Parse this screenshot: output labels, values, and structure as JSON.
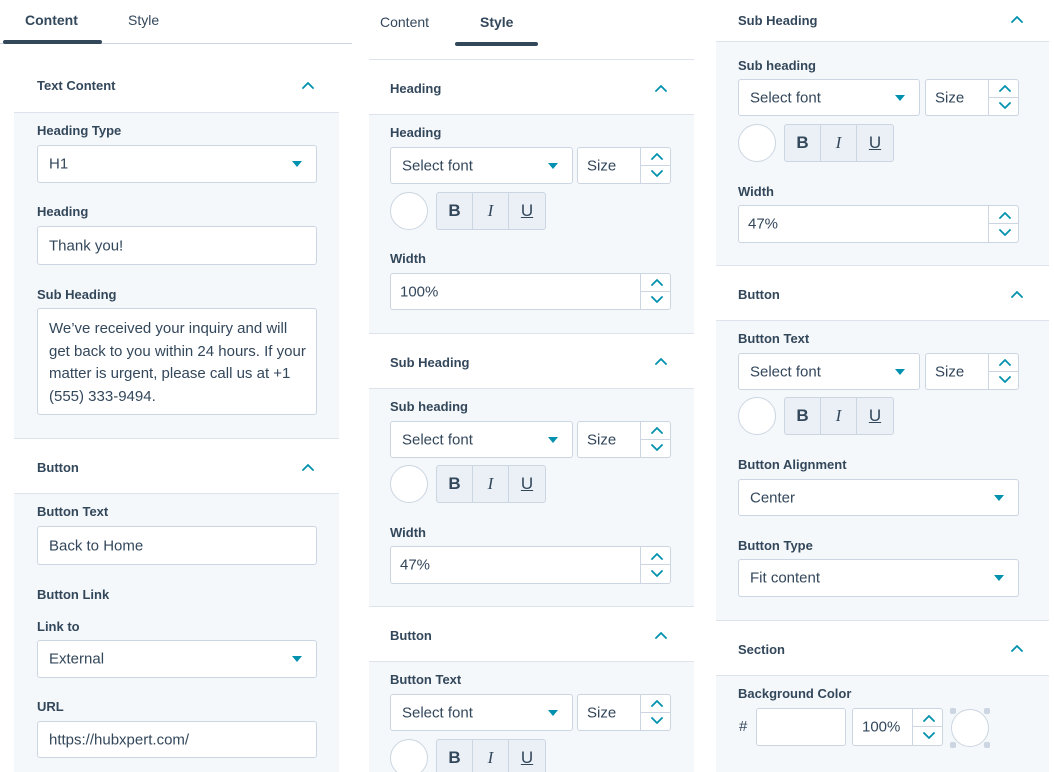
{
  "colors": {
    "accent": "#0091ae",
    "text": "#33475b",
    "border": "#cbd6e2",
    "body_bg": "#f5f8fa",
    "tab_underline": "#33475b"
  },
  "panel1": {
    "tabs": {
      "content": "Content",
      "style": "Style",
      "active": "Content"
    },
    "text_content": {
      "title": "Text Content",
      "heading_type_label": "Heading Type",
      "heading_type_value": "H1",
      "heading_label": "Heading",
      "heading_value": "Thank you!",
      "sub_heading_label": "Sub Heading",
      "sub_heading_value": "We’ve received your inquiry and will get back to you within 24 hours. If your matter is urgent, please call us at +1 (555) 333-9494."
    },
    "button": {
      "title": "Button",
      "text_label": "Button Text",
      "text_value": "Back to Home",
      "link_label": "Button Link",
      "link_to_label": "Link to",
      "link_to_value": "External",
      "url_label": "URL",
      "url_value": "https://hubxpert.com/"
    }
  },
  "panel2": {
    "tabs": {
      "content": "Content",
      "style": "Style",
      "active": "Style"
    },
    "heading": {
      "title": "Heading",
      "label": "Heading",
      "font_placeholder": "Select font",
      "size_placeholder": "Size",
      "bold": "B",
      "italic": "I",
      "underline": "U",
      "width_label": "Width",
      "width_value": "100%"
    },
    "sub_heading": {
      "title": "Sub Heading",
      "label": "Sub heading",
      "font_placeholder": "Select font",
      "size_placeholder": "Size",
      "bold": "B",
      "italic": "I",
      "underline": "U",
      "width_label": "Width",
      "width_value": "47%"
    },
    "button": {
      "title": "Button",
      "label": "Button Text",
      "font_placeholder": "Select font",
      "size_placeholder": "Size",
      "bold": "B",
      "italic": "I",
      "underline": "U"
    }
  },
  "panel3": {
    "sub_heading": {
      "title": "Sub Heading",
      "label": "Sub heading",
      "font_placeholder": "Select font",
      "size_placeholder": "Size",
      "bold": "B",
      "italic": "I",
      "underline": "U",
      "width_label": "Width",
      "width_value": "47%"
    },
    "button": {
      "title": "Button",
      "label": "Button Text",
      "font_placeholder": "Select font",
      "size_placeholder": "Size",
      "bold": "B",
      "italic": "I",
      "underline": "U",
      "alignment_label": "Button Alignment",
      "alignment_value": "Center",
      "type_label": "Button Type",
      "type_value": "Fit content"
    },
    "section": {
      "title": "Section",
      "bg_color_label": "Background Color",
      "hash": "#",
      "hex_value": "",
      "opacity_value": "100%"
    }
  }
}
